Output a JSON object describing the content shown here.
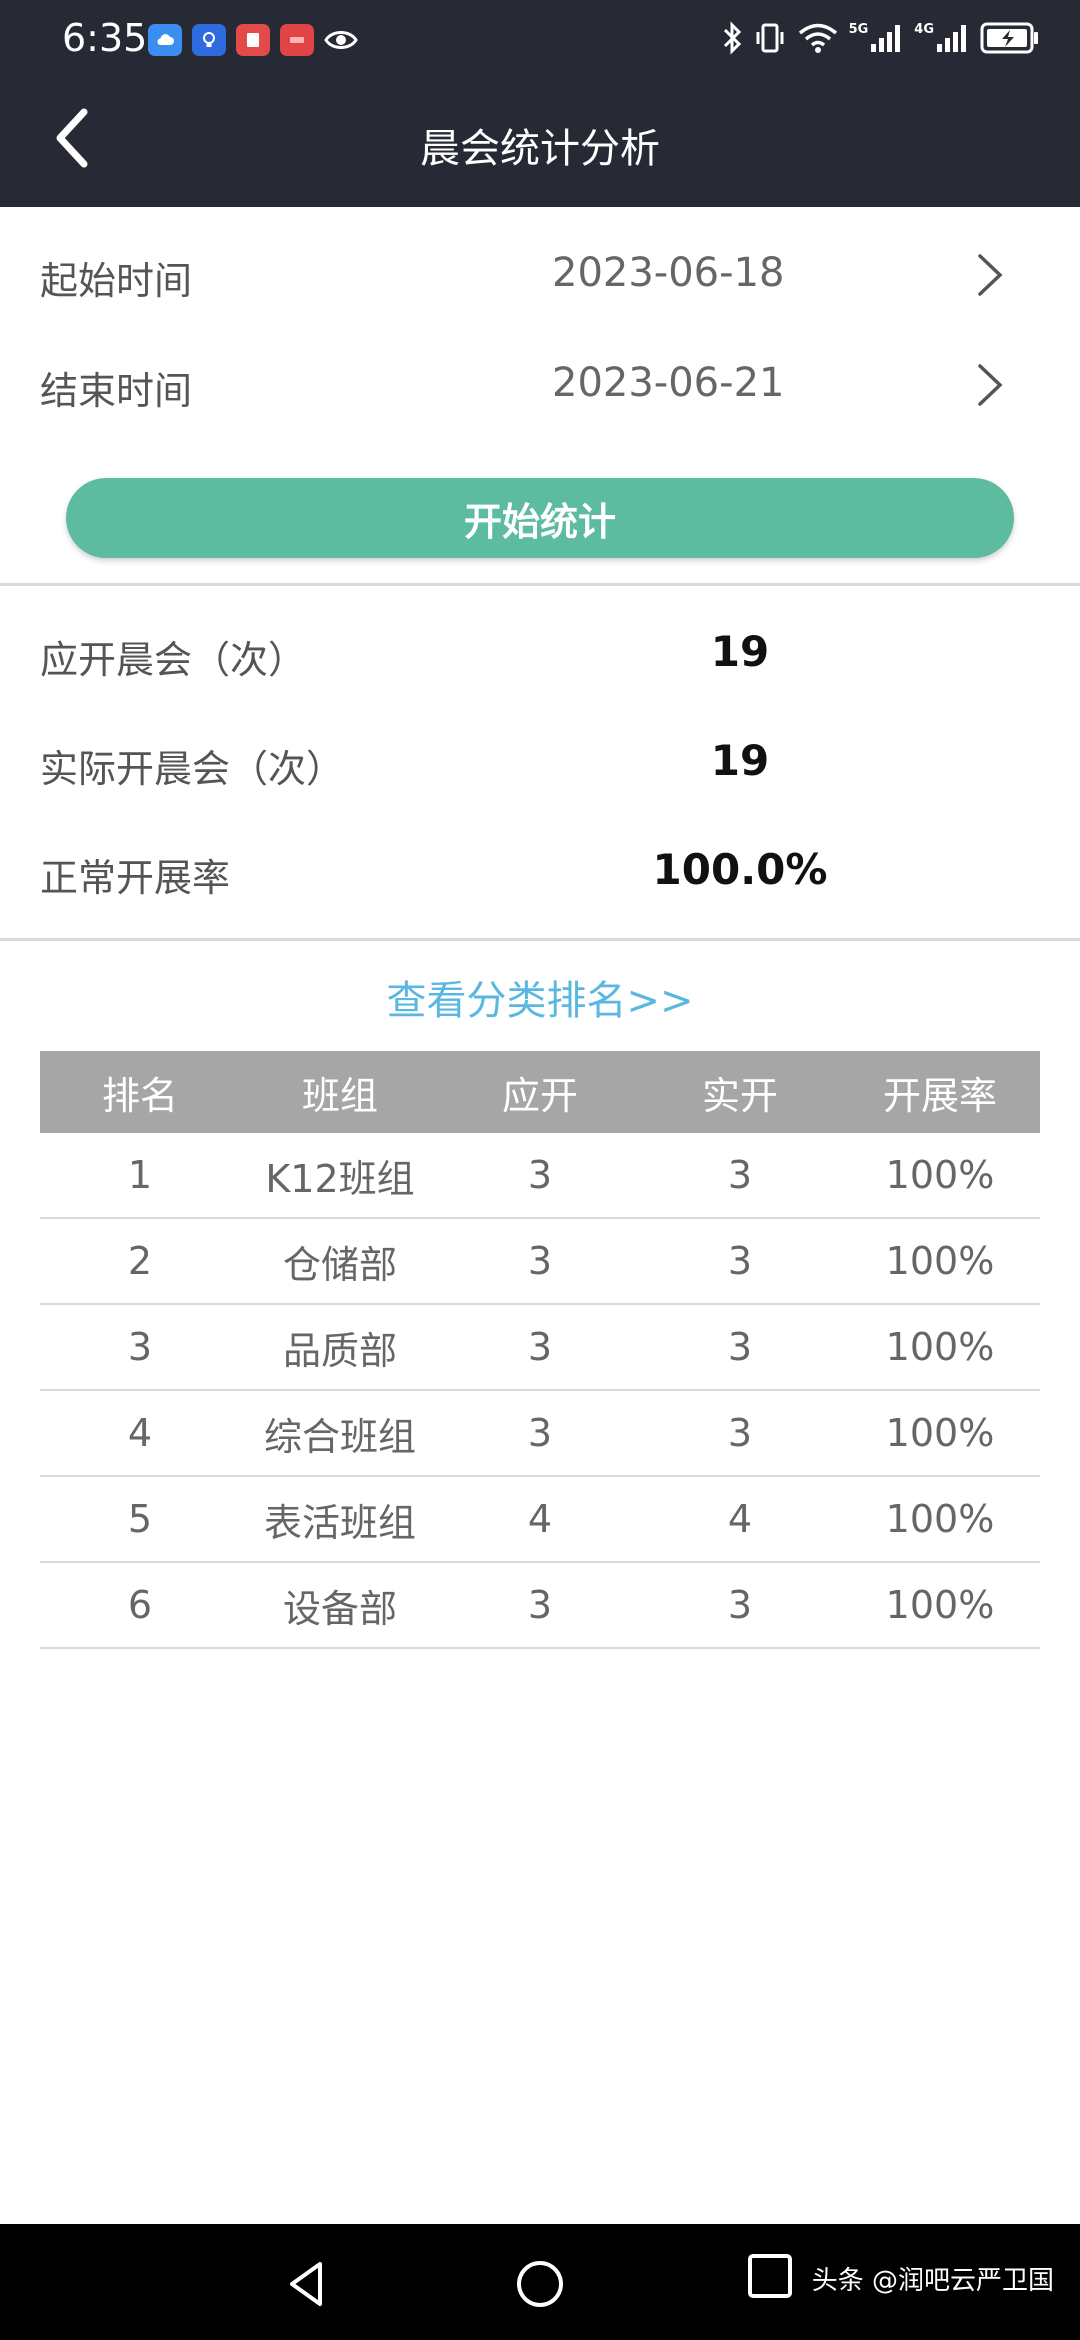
{
  "status_bar": {
    "time": "6:35",
    "network_5g": "5G",
    "network_4g": "4G"
  },
  "header": {
    "title": "晨会统计分析"
  },
  "date_range": {
    "start_label": "起始时间",
    "start_value": "2023-06-18",
    "end_label": "结束时间",
    "end_value": "2023-06-21"
  },
  "start_button": "开始统计",
  "stats": {
    "expected_label": "应开晨会（次）",
    "expected_value": "19",
    "actual_label": "实际开晨会（次）",
    "actual_value": "19",
    "rate_label": "正常开展率",
    "rate_value": "100.0%"
  },
  "rank_link": "查看分类排名>>",
  "table": {
    "headers": [
      "排名",
      "班组",
      "应开",
      "实开",
      "开展率"
    ],
    "rows": [
      [
        "1",
        "K12班组",
        "3",
        "3",
        "100%"
      ],
      [
        "2",
        "仓储部",
        "3",
        "3",
        "100%"
      ],
      [
        "3",
        "品质部",
        "3",
        "3",
        "100%"
      ],
      [
        "4",
        "综合班组",
        "3",
        "3",
        "100%"
      ],
      [
        "5",
        "表活班组",
        "4",
        "4",
        "100%"
      ],
      [
        "6",
        "设备部",
        "3",
        "3",
        "100%"
      ]
    ]
  },
  "watermark": "头条 @润吧云严卫国",
  "colors": {
    "header_bg": "#272a34",
    "accent_button": "#5dbba0",
    "link": "#5ab8e0",
    "table_header_bg": "#a6a6a6"
  }
}
